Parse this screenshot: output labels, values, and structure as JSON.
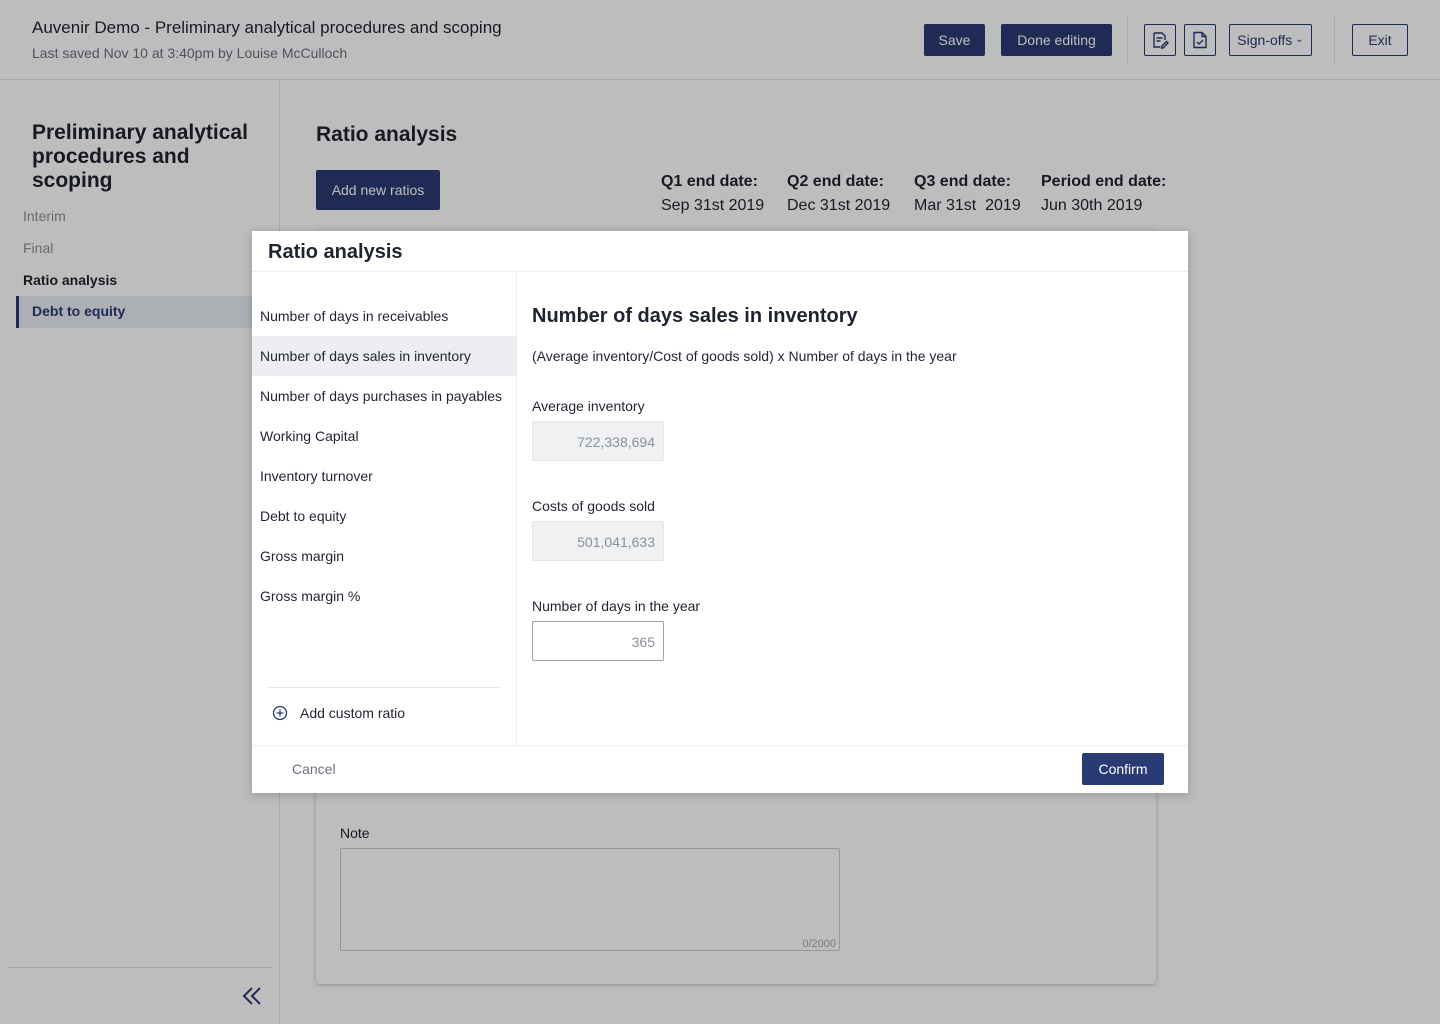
{
  "header": {
    "title": "Auvenir Demo - Preliminary analytical procedures and scoping",
    "subtitle": "Last saved Nov 10 at 3:40pm by Louise McCulloch",
    "save_label": "Save",
    "done_label": "Done editing",
    "signoffs_label": "Sign-offs",
    "exit_label": "Exit"
  },
  "sidebar": {
    "title": "Preliminary analytical procedures and scoping",
    "items": [
      {
        "label": "Interim"
      },
      {
        "label": "Final"
      },
      {
        "label": "Ratio analysis"
      },
      {
        "label": "Debt to equity"
      }
    ]
  },
  "main": {
    "title": "Ratio analysis",
    "add_button": "Add new ratios",
    "dates": [
      {
        "label": "Q1 end date:",
        "value": "Sep 31st 2019"
      },
      {
        "label": "Q2 end date:",
        "value": "Dec 31st 2019"
      },
      {
        "label": "Q3 end date:",
        "value": "Mar 31st  2019"
      },
      {
        "label": "Period end date:",
        "value": "Jun 30th 2019"
      }
    ],
    "note_label": "Note",
    "note_count": "0/2000"
  },
  "modal": {
    "title": "Ratio analysis",
    "ratios": [
      "Number of days in receivables",
      "Number of days sales in inventory",
      "Number of days purchases in payables",
      "Working Capital",
      "Inventory turnover",
      "Debt to equity",
      "Gross margin",
      "Gross margin %"
    ],
    "selected_index": 1,
    "add_custom": "Add custom ratio",
    "detail": {
      "title": "Number of days sales in inventory",
      "formula": "(Average inventory/Cost of goods sold) x Number of days in the year",
      "fields": [
        {
          "label": "Average inventory",
          "value": "722,338,694"
        },
        {
          "label": "Costs of goods sold",
          "value": "501,041,633"
        },
        {
          "label": "Number of days in the year",
          "value": "365"
        }
      ]
    },
    "cancel_label": "Cancel",
    "confirm_label": "Confirm"
  },
  "colors": {
    "brand": "#2a3a73",
    "overlay": "rgba(0,0,0,0.26)"
  },
  "icons": [
    "edit-document-icon",
    "document-check-icon",
    "chevron-down-icon",
    "collapse-left-icon",
    "add-circle-icon"
  ]
}
